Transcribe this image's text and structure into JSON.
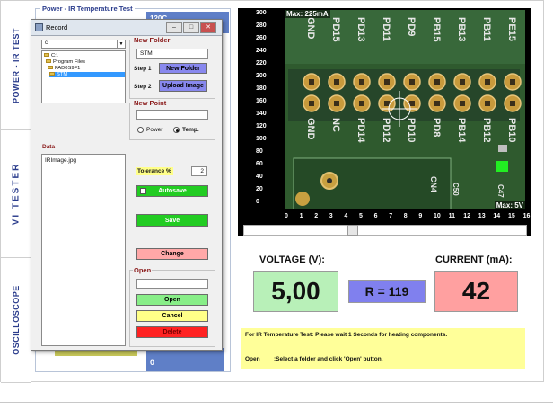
{
  "side_tabs": [
    "POWER - IR TEST",
    "VI TESTER",
    "OSCILLOSCOPE"
  ],
  "panel": {
    "title": "Power - IR Temperature Test",
    "peek_text": "120C",
    "bottom_value": "0"
  },
  "camera": {
    "max_current_label": "Max: 225mA",
    "max_voltage_label": "Max: 5V",
    "y_ticks": [
      "300",
      "280",
      "260",
      "240",
      "220",
      "200",
      "180",
      "160",
      "140",
      "120",
      "100",
      "80",
      "60",
      "40",
      "20",
      "0"
    ],
    "x_ticks": [
      "0",
      "1",
      "2",
      "3",
      "4",
      "5",
      "6",
      "7",
      "8",
      "9",
      "10",
      "11",
      "12",
      "13",
      "14",
      "15",
      "16"
    ],
    "pins_top": [
      "GND",
      "PD15",
      "PD13",
      "PD11",
      "PD9",
      "PB15",
      "PB13",
      "PB11",
      "PE15"
    ],
    "pins_bottom": [
      "GND",
      "NC",
      "PD14",
      "PD12",
      "PD10",
      "PD8",
      "PB14",
      "PB12",
      "PB10"
    ],
    "chip_label": "CN4",
    "side_labels": [
      "C50",
      "C47"
    ]
  },
  "readouts": {
    "voltage_label": "VOLTAGE (V):",
    "voltage_value": "5,00",
    "current_label": "CURRENT (mA):",
    "current_value": "42",
    "resistance": "R = 119"
  },
  "info": {
    "line1": "For IR Temperature Test: Please wait 1 Seconds for heating components.",
    "line2_key": "Open",
    "line2_text": ":Select a folder and click 'Open' button."
  },
  "dialog": {
    "title": "Record",
    "drive": "c",
    "tree": [
      "C:\\",
      "Program Files",
      "FAD0S9F1",
      "STM"
    ],
    "data_label": "Data",
    "data_items": [
      "IRImage.jpg"
    ],
    "new_folder": {
      "label": "New Folder",
      "value": "STM",
      "step1": "Step 1",
      "step1_btn": "New Folder",
      "step2": "Step 2",
      "step2_btn": "Upload Image"
    },
    "new_point": {
      "label": "New Point",
      "value": "",
      "radio_power": "Power",
      "radio_temp": "Temp."
    },
    "tolerance_label": "Tolerance %",
    "tolerance_value": "2",
    "autosave_label": "Autosave",
    "save_btn": "Save",
    "change_btn": "Change",
    "open": {
      "label": "Open",
      "value": "",
      "open_btn": "Open",
      "cancel_btn": "Cancel",
      "delete_btn": "Delete"
    }
  },
  "colors": {
    "green_btn": "#22cc22",
    "light_green_btn": "#88ee88",
    "blue_btn": "#8888ee",
    "red_btn": "#ff2222",
    "pink_btn": "#ffa8a8",
    "yellow_btn": "#ffff88",
    "voltage_bg": "#b8f0b8",
    "current_bg": "#ffa0a0",
    "resistance_bg": "#8080ee"
  }
}
